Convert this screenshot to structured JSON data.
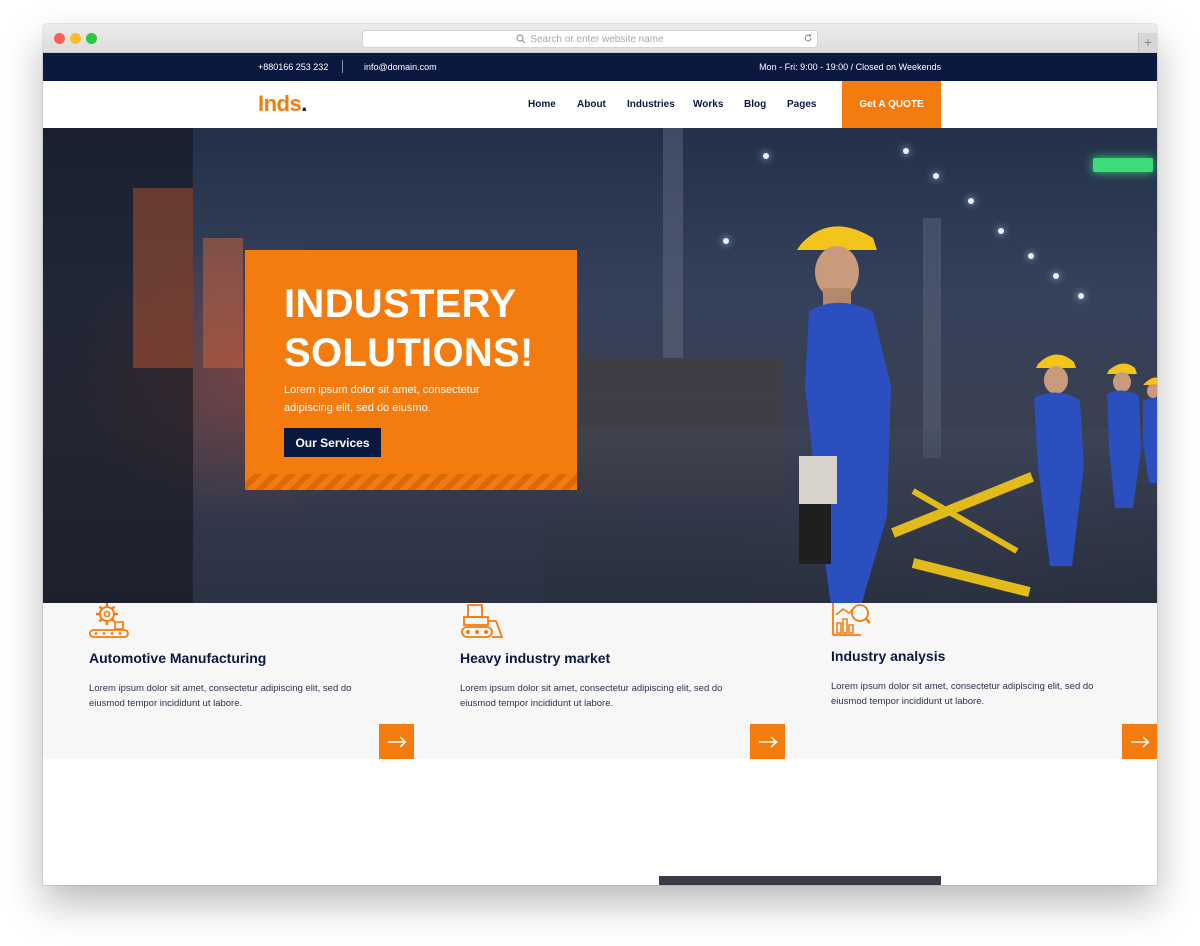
{
  "browser": {
    "address_placeholder": "Search or enter website name",
    "new_tab_label": "+"
  },
  "topbar": {
    "phone": "+880166 253 232",
    "email": "info@domain.com",
    "hours": "Mon - Fri: 9:00 - 19:00 / Closed on Weekends"
  },
  "nav": {
    "logo_text": "Inds",
    "logo_dot": ".",
    "items": [
      {
        "label": "Home"
      },
      {
        "label": "About"
      },
      {
        "label": "Industries"
      },
      {
        "label": "Works"
      },
      {
        "label": "Blog"
      },
      {
        "label": "Pages"
      }
    ],
    "cta_label": "Get A QUOTE"
  },
  "hero": {
    "title_line1": "INDUSTERY",
    "title_line2": "SOLUTIONS!",
    "text": "Lorem ipsum dolor sit amet, consectetur adipiscing elit, sed do eiusmo.",
    "button_label": "Our Services"
  },
  "services": [
    {
      "icon": "gear-conveyor-icon",
      "title": "Automotive Manufacturing",
      "desc": "Lorem ipsum dolor sit amet, consectetur adipiscing elit, sed do eiusmod tempor incididunt ut labore."
    },
    {
      "icon": "bulldozer-icon",
      "title": "Heavy industry market",
      "desc": "Lorem ipsum dolor sit amet, consectetur adipiscing elit, sed do eiusmod tempor incididunt ut labore."
    },
    {
      "icon": "analysis-chart-icon",
      "title": "Industry analysis",
      "desc": "Lorem ipsum dolor sit amet, consectetur adipiscing elit, sed do eiusmod tempor incididunt ut labore."
    }
  ],
  "colors": {
    "accent": "#f47c0e",
    "navy": "#0b1840",
    "services_bg": "#f7f7f7"
  }
}
